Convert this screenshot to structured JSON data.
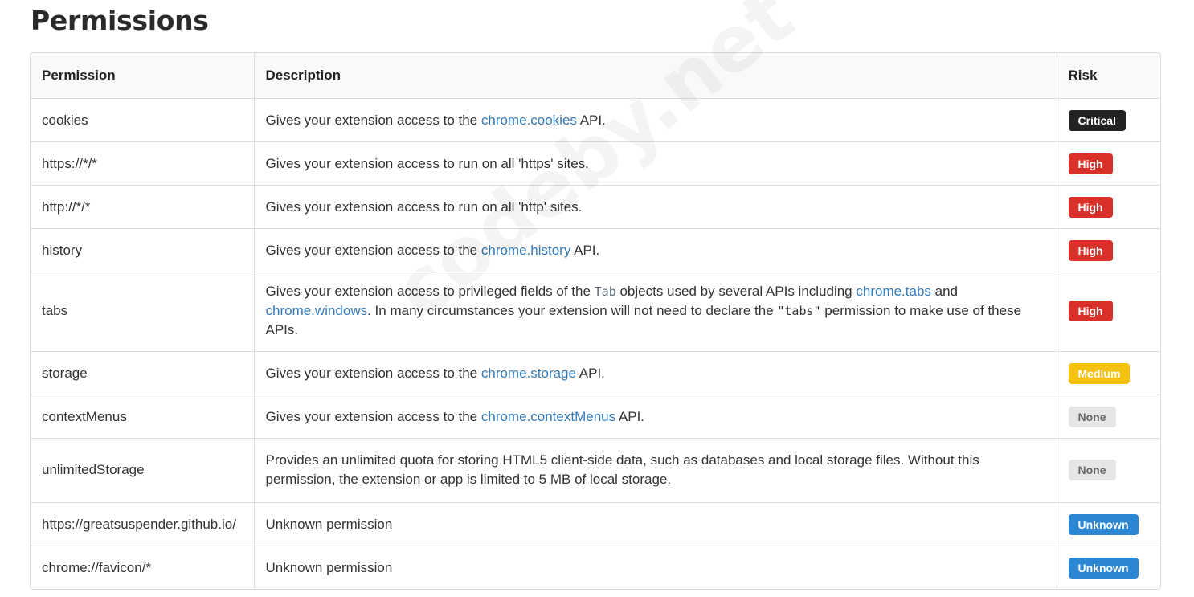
{
  "page": {
    "title": "Permissions",
    "watermark": "codeby.net"
  },
  "colors": {
    "critical": "#222222",
    "high": "#d9302a",
    "medium": "#f5c211",
    "none": "#e6e6e6",
    "unknown": "#2b87d3",
    "link": "#337ab7"
  },
  "table": {
    "headers": {
      "permission": "Permission",
      "description": "Description",
      "risk": "Risk"
    },
    "rows": [
      {
        "permission": "cookies",
        "desc_before": "Gives your extension access to the ",
        "desc_link": "chrome.cookies",
        "desc_after": " API.",
        "risk": "Critical"
      },
      {
        "permission": "https://*/*",
        "description": "Gives your extension access to run on all 'https' sites.",
        "risk": "High"
      },
      {
        "permission": "http://*/*",
        "description": "Gives your extension access to run on all 'http' sites.",
        "risk": "High"
      },
      {
        "permission": "history",
        "desc_before": "Gives your extension access to the ",
        "desc_link": "chrome.history",
        "desc_after": " API.",
        "risk": "High"
      },
      {
        "permission": "tabs",
        "desc_part1": "Gives your extension access to privileged fields of the ",
        "desc_code1": "Tab",
        "desc_part2": " objects used by several APIs including ",
        "desc_link1": "chrome.tabs",
        "desc_part3": " and ",
        "desc_link2": "chrome.windows",
        "desc_part4": ". In many circumstances your extension will not need to declare the ",
        "desc_code2": "\"tabs\"",
        "desc_part5": " permission to make use of these APIs.",
        "risk": "High"
      },
      {
        "permission": "storage",
        "desc_before": "Gives your extension access to the ",
        "desc_link": "chrome.storage",
        "desc_after": " API.",
        "risk": "Medium"
      },
      {
        "permission": "contextMenus",
        "desc_before": "Gives your extension access to the ",
        "desc_link": "chrome.contextMenus",
        "desc_after": " API.",
        "risk": "None"
      },
      {
        "permission": "unlimitedStorage",
        "description": "Provides an unlimited quota for storing HTML5 client-side data, such as databases and local storage files. Without this permission, the extension or app is limited to 5 MB of local storage.",
        "risk": "None"
      },
      {
        "permission": "https://greatsuspender.github.io/",
        "description": "Unknown permission",
        "risk": "Unknown"
      },
      {
        "permission": "chrome://favicon/*",
        "description": "Unknown permission",
        "risk": "Unknown"
      }
    ]
  }
}
